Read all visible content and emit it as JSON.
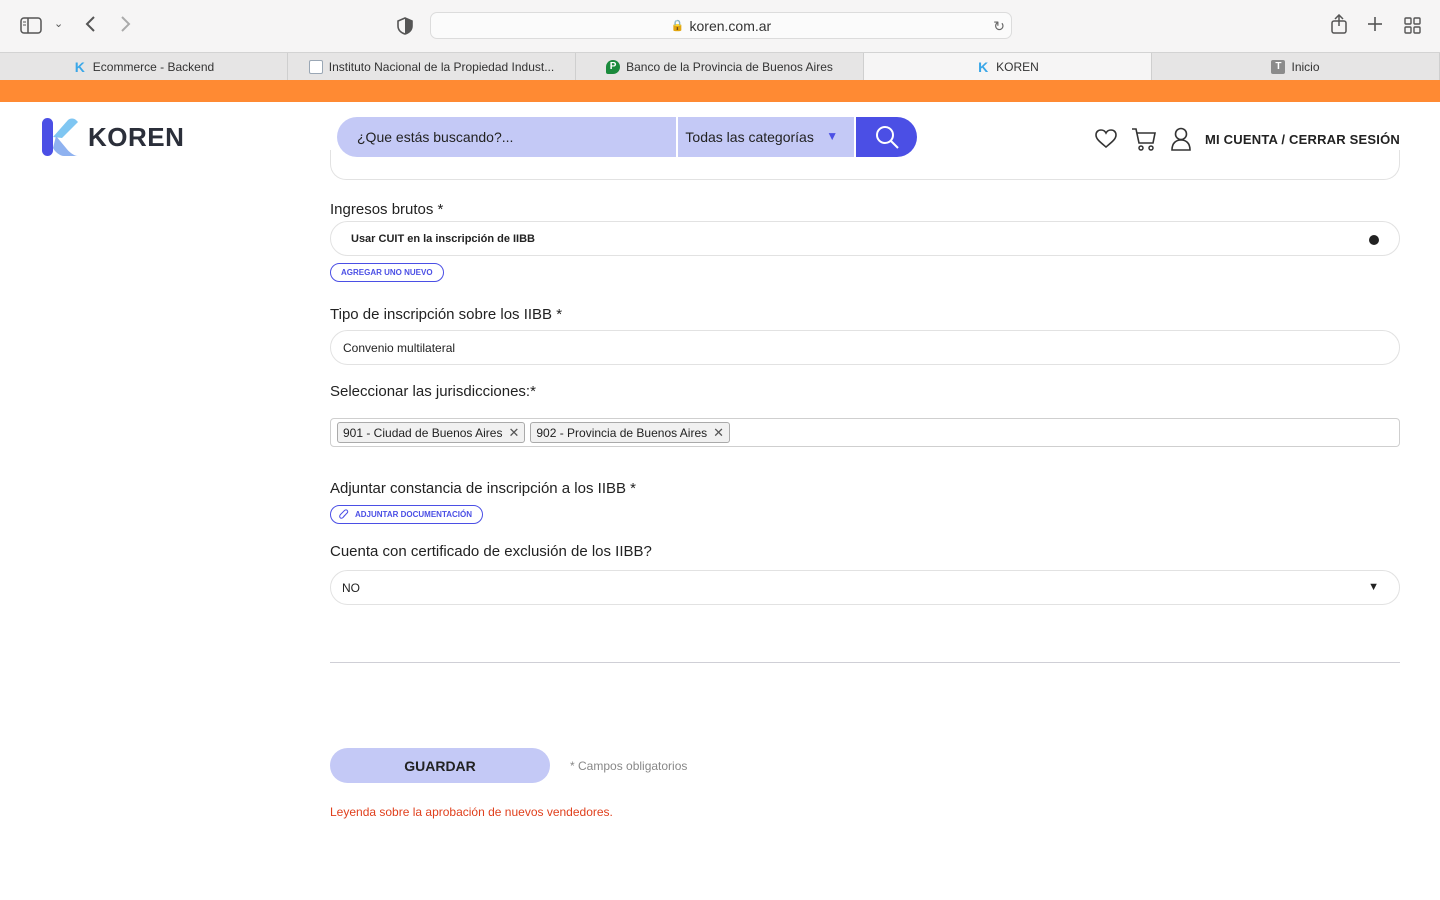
{
  "browser": {
    "url": "koren.com.ar",
    "tabs": [
      {
        "label": "Ecommerce - Backend",
        "fav": "K",
        "color": "#3aa7e8"
      },
      {
        "label": "Instituto Nacional de la Propiedad Indust...",
        "fav": "",
        "color": "#9aa7b5"
      },
      {
        "label": "Banco de la Provincia de Buenos Aires",
        "fav": "P",
        "color": "#1b8a3c"
      },
      {
        "label": "KOREN",
        "fav": "K",
        "color": "#3aa7e8",
        "active": true
      },
      {
        "label": "Inicio",
        "fav": "T",
        "color": "#8b8b8b"
      }
    ]
  },
  "header": {
    "logo_text": "KOREN",
    "search_placeholder": "¿Que estás buscando?...",
    "category": "Todas las categorías",
    "account": "MI CUENTA / CERRAR SESIÓN"
  },
  "form": {
    "iibb_label": "Ingresos brutos *",
    "iibb_value": "Usar CUIT en la inscripción de IIBB",
    "add_new": "AGREGAR UNO NUEVO",
    "tipo_label": "Tipo de inscripción sobre los IIBB *",
    "tipo_value": "Convenio multilateral",
    "juris_label": "Seleccionar las jurisdicciones:*",
    "jurisdictions": [
      "901 - Ciudad de Buenos Aires",
      "902 - Provincia de Buenos Aires"
    ],
    "adjuntar_label": "Adjuntar constancia de inscripción a los IIBB *",
    "adjuntar_btn": "ADJUNTAR DOCUMENTACIÓN",
    "exclusion_label": "Cuenta con certificado de exclusión de los IIBB?",
    "exclusion_value": "NO",
    "save": "GUARDAR",
    "required_note": "* Campos obligatorios",
    "legend": "Leyenda sobre la aprobación de nuevos vendedores."
  },
  "colors": {
    "accent": "#4b4fe5",
    "accent_light": "#c4c9f6",
    "orange": "#ff8a33",
    "error": "#e0401d"
  }
}
